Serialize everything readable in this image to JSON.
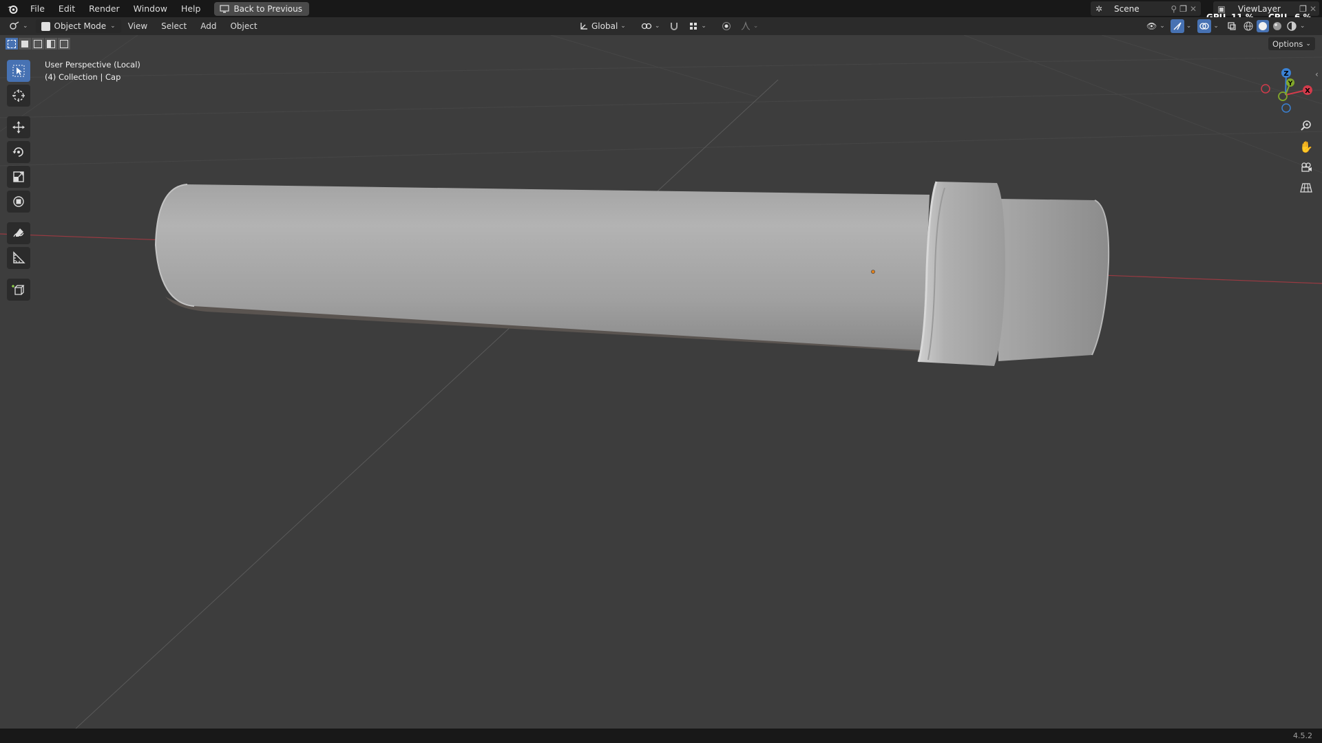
{
  "topbar": {
    "menus": [
      "File",
      "Edit",
      "Render",
      "Window",
      "Help"
    ],
    "back_button": "Back to Previous",
    "scene_name": "Scene",
    "view_layer": "ViewLayer",
    "gpu_label": "GPU",
    "gpu_value": "11 %",
    "cpu_label": "CPU",
    "cpu_value": "6 %"
  },
  "header": {
    "mode": "Object Mode",
    "menus": [
      "View",
      "Select",
      "Add",
      "Object"
    ],
    "transform_orientation": "Global",
    "options": "Options"
  },
  "viewport": {
    "perspective_label": "User Perspective (Local)",
    "collection_label": "(4) Collection | Cap",
    "gizmo": {
      "z": "Z",
      "y": "Y",
      "x": "X"
    }
  },
  "status": {
    "version": "4.5.2"
  },
  "colors": {
    "accent": "#4772b3",
    "x_axis": "#d33b4b",
    "y_axis": "#82a82a",
    "z_axis": "#3b82d4",
    "origin": "#e0811e"
  }
}
